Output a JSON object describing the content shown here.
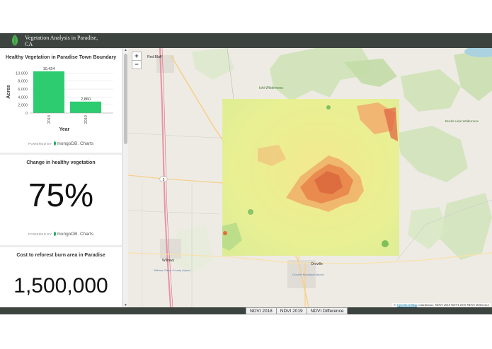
{
  "header": {
    "title": "Vegetation Analysis in Paradise, CA",
    "logo_icon": "leaf-icon",
    "bg_color": "#3d4440"
  },
  "sidebar": {
    "chart_card": {
      "title": "Healthy Vegetation in Paradise Town Boundary",
      "powered_prefix": "POWERED BY",
      "powered_brand": "mongoDB. Charts"
    },
    "change_card": {
      "title": "Change in healthy vegetation",
      "value": "75%",
      "powered_prefix": "POWERED BY",
      "powered_brand": "mongoDB. Charts"
    },
    "cost_card": {
      "title": "Cost to reforest burn area in Paradise",
      "value": "1,500,000"
    }
  },
  "chart_data": {
    "type": "bar",
    "title": "Healthy Vegetation in Paradise Town Boundary",
    "categories": [
      "2018",
      "2019"
    ],
    "values": [
      10424,
      2860
    ],
    "value_labels": [
      "10,424",
      "2,860"
    ],
    "xlabel": "Year",
    "ylabel": "Acres",
    "yticks": [
      "0",
      "2,000",
      "4,000",
      "6,000",
      "8,000",
      "10,000"
    ],
    "ytick_values": [
      0,
      2000,
      4000,
      6000,
      8000,
      10000
    ],
    "ylim": [
      0,
      10600
    ],
    "bar_color": "#2ecc71",
    "grid": true
  },
  "map": {
    "zoom_in": "+",
    "zoom_out": "−",
    "labels": {
      "red_bluff": "Red Bluff",
      "ishi": "Ishi Wilderness",
      "bucks_lake": "Bucks Lake Wilderness",
      "willows": "Willows",
      "glenn": "Willows Glenn County Airport",
      "oroville": "Oroville",
      "oroville_airport": "Oroville Municipal Airport",
      "i5": "5"
    },
    "attribution_prefix": "©",
    "attribution_link": "OpenStreetMap",
    "attribution_rest": "contributors. NDVI 2018 NDVI 2019 NDVI Difference"
  },
  "bottom_tabs": [
    "NDVI 2018",
    "NDVI 2019",
    "NDVI Difference"
  ]
}
